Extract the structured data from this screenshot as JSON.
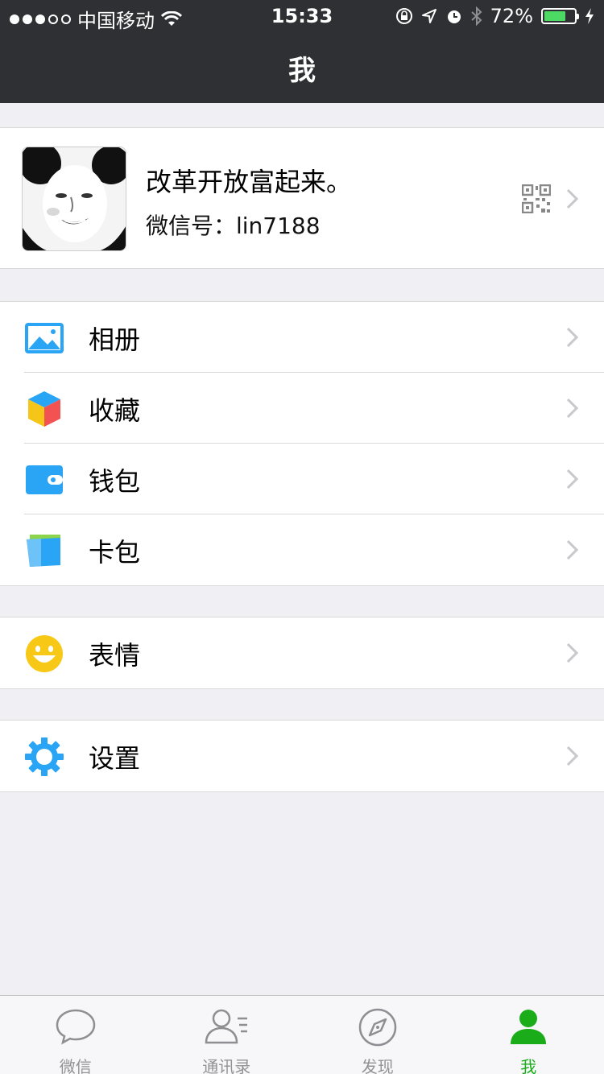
{
  "status_bar": {
    "carrier": "中国移动",
    "time": "15:33",
    "battery": "72%",
    "battery_level": 0.72
  },
  "header": {
    "title": "我"
  },
  "profile": {
    "name": "改革开放富起来。",
    "wechat_id": "微信号：lin7188"
  },
  "groups": [
    [
      {
        "id": "album",
        "label": "相册",
        "icon": "album-icon"
      },
      {
        "id": "favorites",
        "label": "收藏",
        "icon": "favorites-cube-icon"
      },
      {
        "id": "wallet",
        "label": "钱包",
        "icon": "wallet-icon"
      },
      {
        "id": "card-pack",
        "label": "卡包",
        "icon": "card-pack-icon"
      }
    ],
    [
      {
        "id": "stickers",
        "label": "表情",
        "icon": "smiley-icon"
      }
    ],
    [
      {
        "id": "settings",
        "label": "设置",
        "icon": "gear-icon"
      }
    ]
  ],
  "tabbar": [
    {
      "id": "chats",
      "label": "微信",
      "icon": "chat-bubble-icon",
      "active": false
    },
    {
      "id": "contacts",
      "label": "通讯录",
      "icon": "contacts-icon",
      "active": false
    },
    {
      "id": "discover",
      "label": "发现",
      "icon": "compass-icon",
      "active": false
    },
    {
      "id": "me",
      "label": "我",
      "icon": "person-icon",
      "active": true
    }
  ],
  "colors": {
    "header_bg": "#2f3033",
    "accent_green": "#1aad19",
    "page_bg": "#efeff4"
  }
}
